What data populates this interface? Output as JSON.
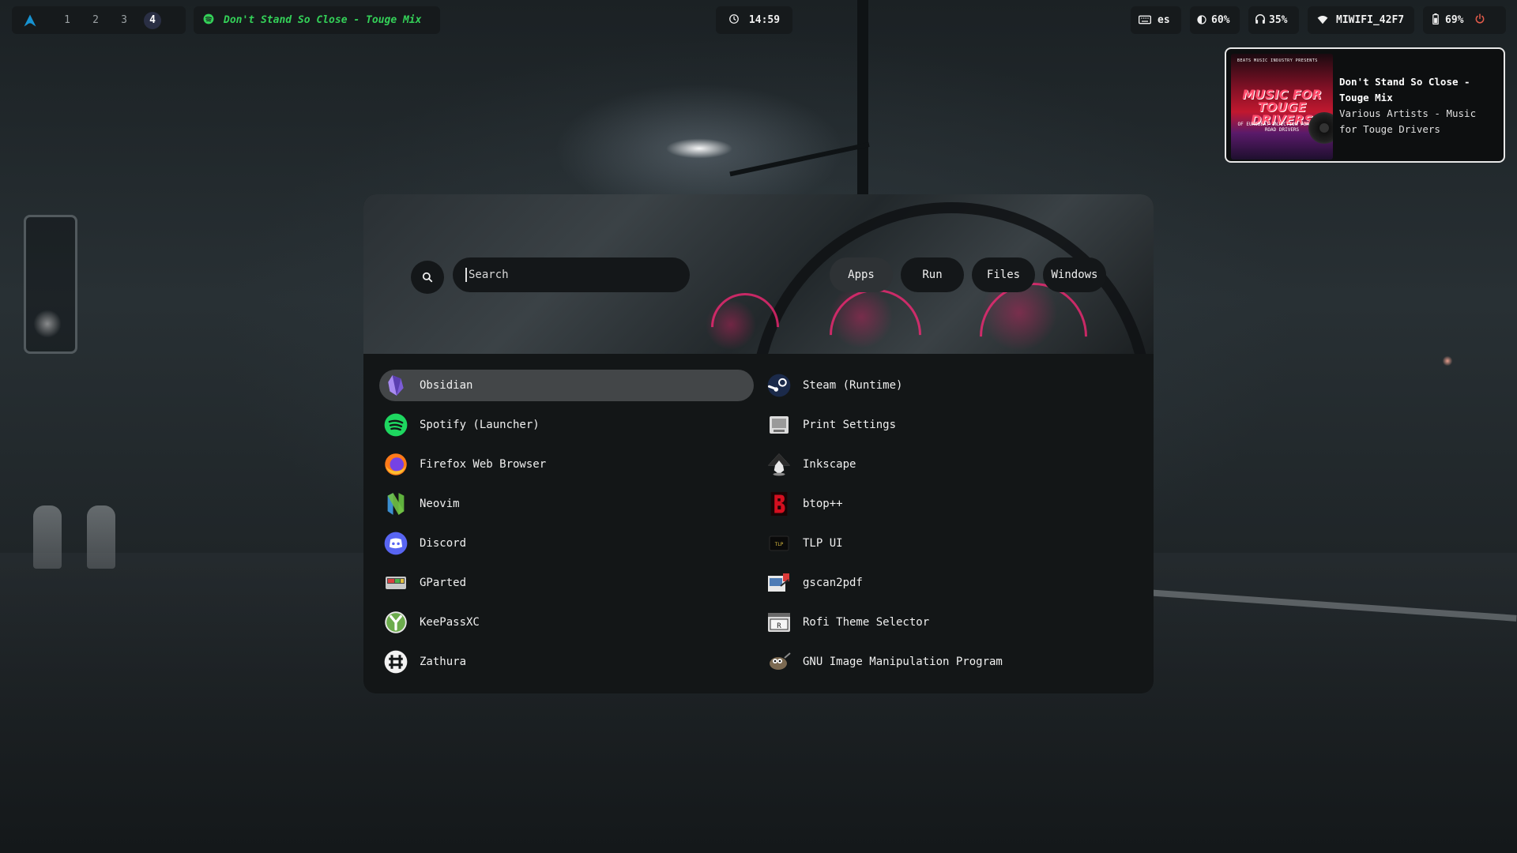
{
  "topbar": {
    "workspaces": [
      "1",
      "2",
      "3",
      "4"
    ],
    "active_workspace": "4",
    "now_playing": "Don't Stand So Close - Touge Mix",
    "clock": "14:59",
    "keyboard_layout": "es",
    "brightness": "60%",
    "volume": "35%",
    "wifi_ssid": "MIWIFI_42F7",
    "battery": "69%",
    "accent_color": "#34d058"
  },
  "notification": {
    "title": "Don't Stand So Close - Touge Mix",
    "body": "Various Artists - Music for Touge Drivers",
    "album_art": {
      "small_text": "BEATS MUSIC INDUSTRY PRESENTS",
      "title": "MUSIC FOR TOUGE DRIVERS",
      "subtitle": "OF EUROBEAT INJECTION FOR TOUGE ROAD DRIVERS"
    }
  },
  "launcher": {
    "search_placeholder": "Search",
    "modes": [
      "Apps",
      "Run",
      "Files",
      "Windows"
    ],
    "active_mode": "Apps",
    "apps": [
      {
        "label": "Obsidian",
        "icon": "obsidian-icon",
        "selected": true
      },
      {
        "label": "Steam (Runtime)",
        "icon": "steam-icon"
      },
      {
        "label": "Spotify (Launcher)",
        "icon": "spotify-icon"
      },
      {
        "label": "Print Settings",
        "icon": "printer-icon"
      },
      {
        "label": "Firefox Web Browser",
        "icon": "firefox-icon"
      },
      {
        "label": "Inkscape",
        "icon": "inkscape-icon"
      },
      {
        "label": "Neovim",
        "icon": "neovim-icon"
      },
      {
        "label": "btop++",
        "icon": "btop-icon"
      },
      {
        "label": "Discord",
        "icon": "discord-icon"
      },
      {
        "label": "TLP UI",
        "icon": "tlp-icon"
      },
      {
        "label": "GParted",
        "icon": "gparted-icon"
      },
      {
        "label": "gscan2pdf",
        "icon": "gscan2pdf-icon"
      },
      {
        "label": "KeePassXC",
        "icon": "keepassxc-icon"
      },
      {
        "label": "Rofi Theme Selector",
        "icon": "rofi-theme-icon"
      },
      {
        "label": "Zathura",
        "icon": "zathura-icon"
      },
      {
        "label": "GNU Image Manipulation Program",
        "icon": "gimp-icon"
      }
    ]
  }
}
